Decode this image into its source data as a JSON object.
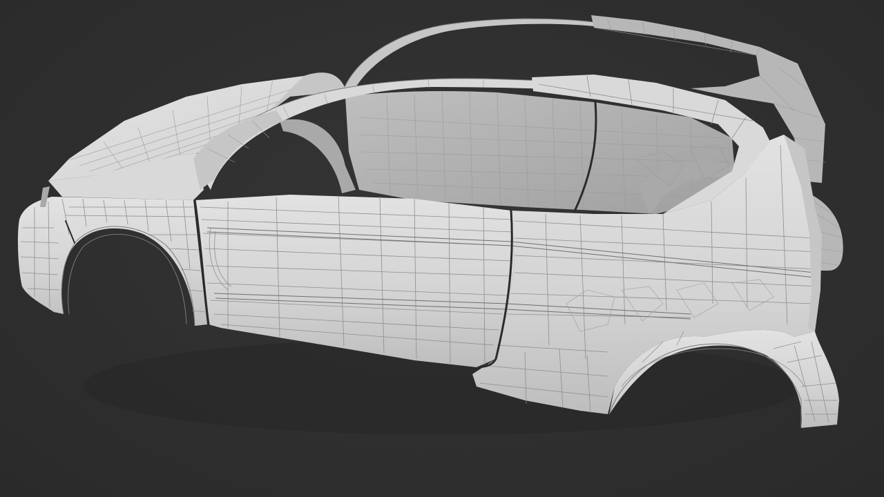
{
  "scene": {
    "subject": "car-body-wireframe-mesh",
    "colors": {
      "background": "#2e2e2e",
      "panel": "#d9d9d9",
      "wireframe": "#8d8d8d",
      "seam": "#2a2a2a"
    }
  }
}
